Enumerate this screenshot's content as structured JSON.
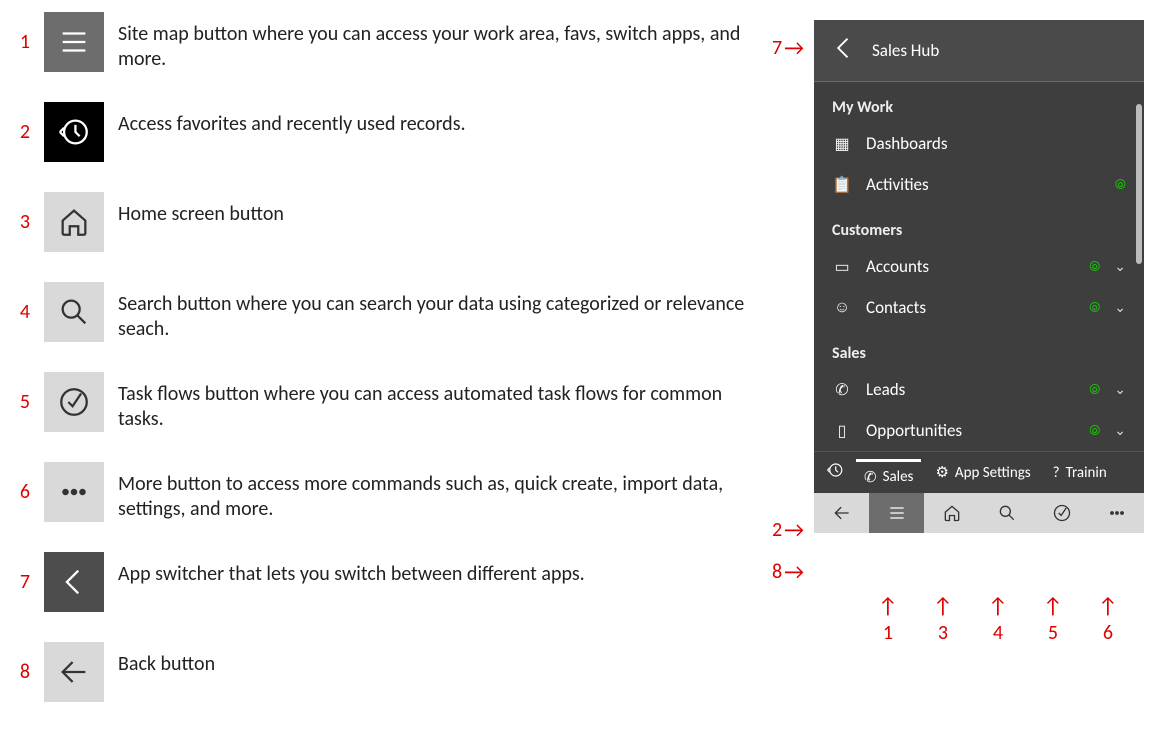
{
  "legend": [
    {
      "num": "1",
      "icon_name": "hamburger-icon",
      "style": "icon-gray-dark",
      "text": "Site map button where you can access your work area, favs, switch apps, and more."
    },
    {
      "num": "2",
      "icon_name": "recent-icon",
      "style": "icon-black",
      "text": "Access favorites and recently used records."
    },
    {
      "num": "3",
      "icon_name": "home-icon",
      "style": "icon-gray-lite",
      "text": "Home screen button"
    },
    {
      "num": "4",
      "icon_name": "search-icon",
      "style": "icon-gray-lite",
      "text": "Search button where you can search your data using categorized or relevance seach."
    },
    {
      "num": "5",
      "icon_name": "taskflow-icon",
      "style": "icon-gray-lite",
      "text": "Task flows button where you can access automated task flows for common tasks."
    },
    {
      "num": "6",
      "icon_name": "more-icon",
      "style": "icon-gray-lite",
      "text": "More button to access more commands such as, quick create, import data, settings, and more."
    },
    {
      "num": "7",
      "icon_name": "chevron-left-icon",
      "style": "icon-gray-med",
      "text": "App switcher that lets you switch between different apps."
    },
    {
      "num": "8",
      "icon_name": "back-arrow-icon",
      "style": "icon-gray-lite",
      "text": "Back button"
    }
  ],
  "phone": {
    "header_title": "Sales Hub",
    "sections": [
      {
        "title": "My Work",
        "items": [
          {
            "icon": "dashboard-icon",
            "label": "Dashboards",
            "wifi": false,
            "chevron": false
          },
          {
            "icon": "activity-icon",
            "label": "Activities",
            "wifi": true,
            "chevron": false
          }
        ]
      },
      {
        "title": "Customers",
        "items": [
          {
            "icon": "account-icon",
            "label": "Accounts",
            "wifi": true,
            "chevron": true
          },
          {
            "icon": "contact-icon",
            "label": "Contacts",
            "wifi": true,
            "chevron": true
          }
        ]
      },
      {
        "title": "Sales",
        "items": [
          {
            "icon": "leads-icon",
            "label": "Leads",
            "wifi": true,
            "chevron": true
          },
          {
            "icon": "opportunity-icon",
            "label": "Opportunities",
            "wifi": true,
            "chevron": true
          }
        ]
      }
    ],
    "tabs": [
      {
        "icon": "recent-icon",
        "label": "",
        "name": "tab-recent"
      },
      {
        "icon": "phone-icon",
        "label": "Sales",
        "name": "tab-sales",
        "active": true
      },
      {
        "icon": "gear-icon",
        "label": "App Settings",
        "name": "tab-settings"
      },
      {
        "icon": "help-icon",
        "label": "Trainin",
        "name": "tab-training"
      }
    ],
    "bottom": [
      {
        "icon": "back-arrow-icon",
        "name": "bottom-back"
      },
      {
        "icon": "hamburger-icon",
        "name": "bottom-sitemap",
        "dark": true
      },
      {
        "icon": "home-icon",
        "name": "bottom-home"
      },
      {
        "icon": "search-icon",
        "name": "bottom-search"
      },
      {
        "icon": "taskflow-icon",
        "name": "bottom-taskflow"
      },
      {
        "icon": "more-icon",
        "name": "bottom-more"
      }
    ]
  },
  "callouts_right": {
    "top": "7",
    "mid": "2",
    "left8": "8",
    "bottom": [
      "1",
      "3",
      "4",
      "5",
      "6"
    ]
  }
}
